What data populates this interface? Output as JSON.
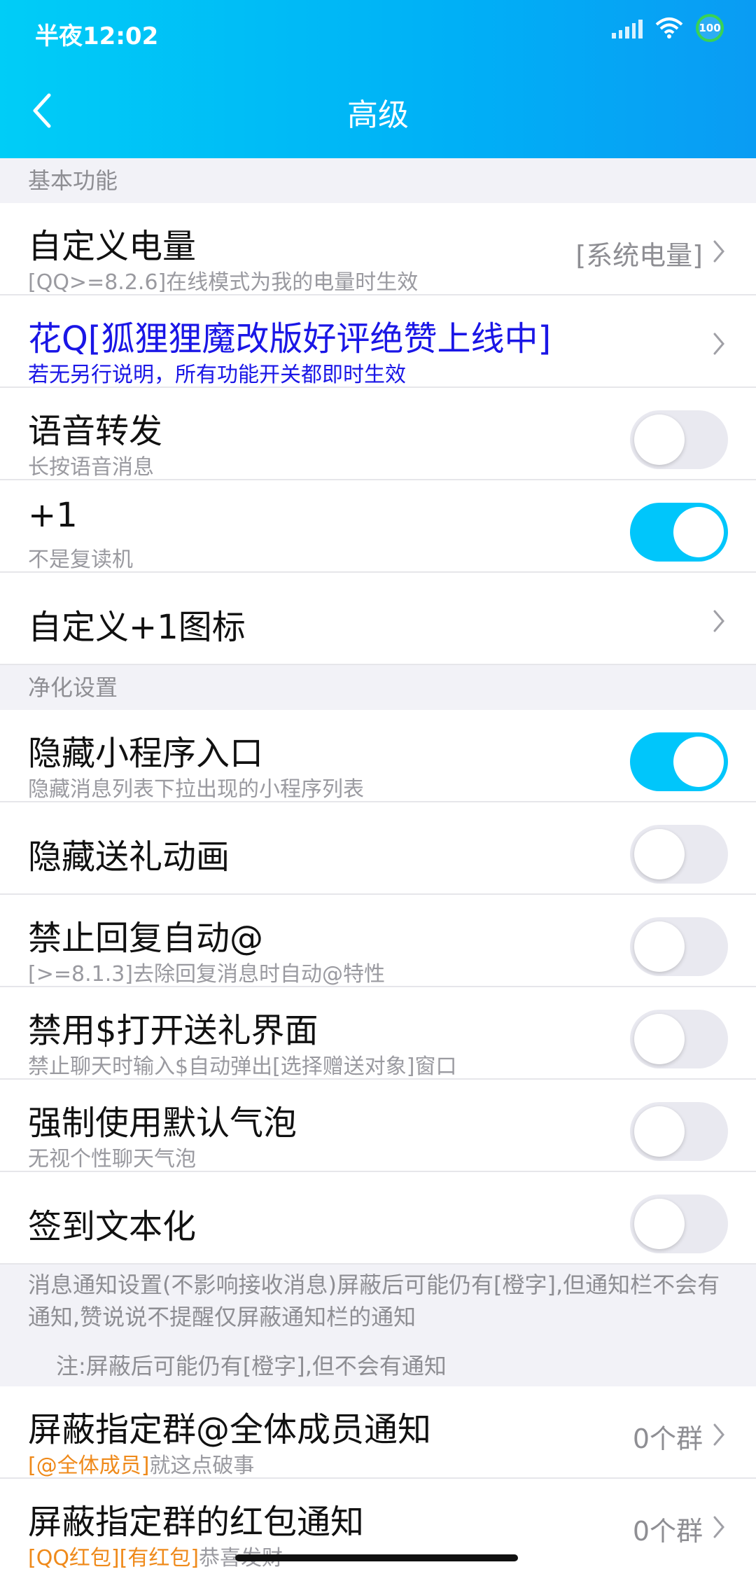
{
  "status": {
    "time": "半夜12:02",
    "battery": "100"
  },
  "header": {
    "title": "高级"
  },
  "sections": {
    "basic": "基本功能",
    "purify": "净化设置"
  },
  "rows": {
    "custom_battery": {
      "title": "自定义电量",
      "subtitle": "[QQ>=8.2.6]在线模式为我的电量时生效",
      "value": "[系统电量]"
    },
    "huaq": {
      "title": "花Q[狐狸狸魔改版好评绝赞上线中]",
      "subtitle": "若无另行说明，所有功能开关都即时生效"
    },
    "voice_forward": {
      "title": "语音转发",
      "subtitle": "长按语音消息",
      "on": false
    },
    "plus_one": {
      "title": " +1",
      "subtitle": "不是复读机",
      "on": true
    },
    "custom_plus_one_icon": {
      "title": "自定义+1图标"
    },
    "hide_miniapp": {
      "title": "隐藏小程序入口",
      "subtitle": "隐藏消息列表下拉出现的小程序列表",
      "on": true
    },
    "hide_gift_anim": {
      "title": "隐藏送礼动画",
      "on": false
    },
    "no_auto_at": {
      "title": "禁止回复自动@",
      "subtitle": "[>=8.1.3]去除回复消息时自动@特性",
      "on": false
    },
    "no_dollar_gift": {
      "title": "禁用$打开送礼界面",
      "subtitle": "禁止聊天时输入$自动弹出[选择赠送对象]窗口",
      "on": false
    },
    "force_default_bubble": {
      "title": "强制使用默认气泡",
      "subtitle": "无视个性聊天气泡",
      "on": false
    },
    "checkin_text": {
      "title": "签到文本化",
      "on": false
    },
    "block_at_all": {
      "title": "屏蔽指定群@全体成员通知",
      "subtitle_highlight": "[@全体成员]",
      "subtitle_rest": "就这点破事",
      "value": "0个群"
    },
    "block_red_packet": {
      "title": "屏蔽指定群的红包通知",
      "subtitle_highlight": "[QQ红包][有红包]",
      "subtitle_rest": "恭喜发财",
      "value": "0个群"
    }
  },
  "notes": {
    "notify_info": "消息通知设置(不影响接收消息)屏蔽后可能仍有[橙字],但通知栏不会有通知,赞说说不提醒仅屏蔽通知栏的通知",
    "notify_note": "注:屏蔽后可能仍有[橙字],但不会有通知"
  },
  "colors": {
    "accent": "#00c6fb",
    "link_blue": "#1a16e6",
    "orange": "#ef8a1b"
  }
}
